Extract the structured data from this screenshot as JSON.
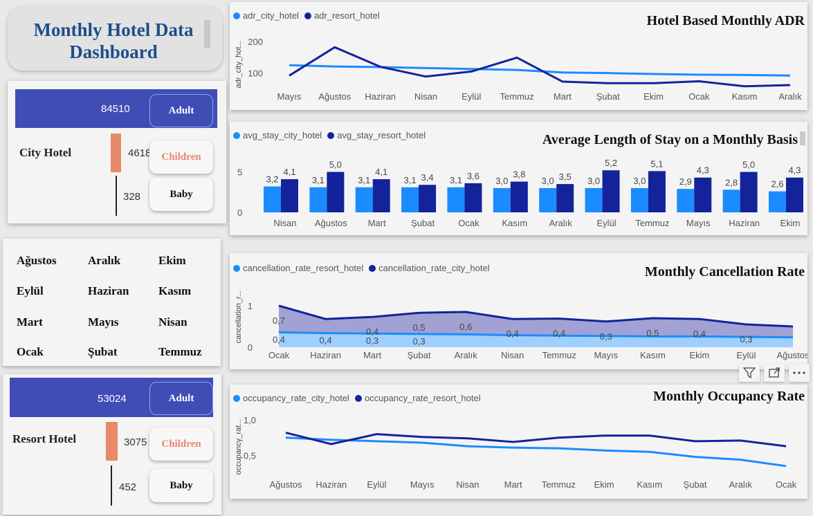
{
  "dashboard": {
    "title_line1": "Monthly Hotel Data",
    "title_line2": "Dashboard"
  },
  "city_guests": {
    "hotel_label": "City Hotel",
    "adult_value": "84510",
    "children_value": "4618",
    "baby_value": "328",
    "adult_label": "Adult",
    "children_label": "Children",
    "baby_label": "Baby"
  },
  "resort_guests": {
    "hotel_label": "Resort Hotel",
    "adult_value": "53024",
    "children_value": "3075",
    "baby_value": "452",
    "adult_label": "Adult",
    "children_label": "Children",
    "baby_label": "Baby"
  },
  "month_slicer": [
    "Ağustos",
    "Aralık",
    "Ekim",
    "Eylül",
    "Haziran",
    "Kasım",
    "Mart",
    "Mayıs",
    "Nisan",
    "Ocak",
    "Şubat",
    "Temmuz"
  ],
  "colors": {
    "city": "#1a8cff",
    "resort": "#14239a",
    "accent": "#3f4db5",
    "orange": "#e8896a"
  },
  "chart_data": [
    {
      "type": "line",
      "title": "Hotel Based Monthly ADR",
      "ylabel": "adr_city_hot...",
      "yticks": [
        "100",
        "200"
      ],
      "ylim": [
        40,
        220
      ],
      "categories": [
        "Mayıs",
        "Ağustos",
        "Haziran",
        "Nisan",
        "Eylül",
        "Temmuz",
        "Mart",
        "Şubat",
        "Ekim",
        "Ocak",
        "Kasım",
        "Aralık"
      ],
      "series": [
        {
          "name": "adr_city_hotel",
          "values": [
            125,
            121,
            119,
            116,
            113,
            110,
            102,
            100,
            97,
            95,
            94,
            92
          ]
        },
        {
          "name": "adr_resort_hotel",
          "values": [
            92,
            182,
            120,
            89,
            105,
            149,
            73,
            68,
            68,
            74,
            58,
            62
          ]
        }
      ]
    },
    {
      "type": "bar",
      "title": "Average Length of Stay on a Monthly Basis",
      "yticks": [
        "0",
        "5"
      ],
      "ylim": [
        0,
        6.5
      ],
      "categories": [
        "Nisan",
        "Ağustos",
        "Mart",
        "Şubat",
        "Ocak",
        "Kasım",
        "Aralık",
        "Eylül",
        "Temmuz",
        "Mayıs",
        "Haziran",
        "Ekim"
      ],
      "series": [
        {
          "name": "avg_stay_city_hotel",
          "values": [
            3.2,
            3.1,
            3.1,
            3.1,
            3.1,
            3.0,
            3.0,
            3.0,
            3.0,
            2.9,
            2.8,
            2.6
          ],
          "labels": [
            "3,2",
            "3,1",
            "3,1",
            "3,1",
            "3,1",
            "3,0",
            "3,0",
            "3,0",
            "3,0",
            "2,9",
            "2,8",
            "2,6"
          ]
        },
        {
          "name": "avg_stay_resort_hotel",
          "values": [
            4.1,
            5.0,
            4.1,
            3.4,
            3.6,
            3.8,
            3.5,
            5.2,
            5.1,
            4.3,
            5.0,
            4.3
          ],
          "labels": [
            "4,1",
            "5,0",
            "4,1",
            "3,4",
            "3,6",
            "3,8",
            "3,5",
            "5,2",
            "5,1",
            "4,3",
            "5,0",
            "4,3"
          ]
        }
      ]
    },
    {
      "type": "area",
      "title": "Monthly Cancellation Rate",
      "ylabel": "cancellation_r...",
      "yticks": [
        "0",
        "1"
      ],
      "ylim": [
        0,
        1.1
      ],
      "categories": [
        "Ocak",
        "Haziran",
        "Mart",
        "Şubat",
        "Aralık",
        "Nisan",
        "Temmuz",
        "Mayıs",
        "Kasım",
        "Ekim",
        "Eylül",
        "Ağustos"
      ],
      "series": [
        {
          "name": "cancellation_rate_resort_hotel",
          "values": [
            0.36,
            0.34,
            0.33,
            0.32,
            0.31,
            0.29,
            0.28,
            0.27,
            0.26,
            0.26,
            0.25,
            0.24
          ],
          "labels": [
            "0,4",
            "0,4",
            "0,3",
            "0,3",
            "",
            "",
            "",
            "",
            "",
            "",
            "",
            ""
          ]
        },
        {
          "name": "cancellation_rate_city_hotel",
          "values": [
            1.0,
            0.68,
            0.73,
            0.83,
            0.85,
            0.68,
            0.69,
            0.62,
            0.7,
            0.68,
            0.55,
            0.5
          ],
          "labels": [
            "0,7",
            "",
            "0,4",
            "0,5",
            "0,6",
            "0,4",
            "0,4",
            "0,3",
            "0,5",
            "0,4",
            "0,3",
            ""
          ]
        }
      ]
    },
    {
      "type": "line",
      "title": "Monthly Occupancy Rate",
      "ylabel": "occupancy_rat...",
      "yticks": [
        "0,5",
        "1,0"
      ],
      "ylim": [
        0.28,
        1.05
      ],
      "categories": [
        "Ağustos",
        "Haziran",
        "Eylül",
        "Mayıs",
        "Nisan",
        "Mart",
        "Temmuz",
        "Ekim",
        "Kasım",
        "Şubat",
        "Aralık",
        "Ocak"
      ],
      "series": [
        {
          "name": "occupancy_rate_city_hotel",
          "values": [
            0.75,
            0.72,
            0.7,
            0.68,
            0.63,
            0.61,
            0.6,
            0.57,
            0.55,
            0.48,
            0.44,
            0.35
          ]
        },
        {
          "name": "occupancy_rate_resort_hotel",
          "values": [
            0.82,
            0.66,
            0.8,
            0.76,
            0.74,
            0.69,
            0.75,
            0.78,
            0.78,
            0.7,
            0.71,
            0.63
          ]
        }
      ]
    }
  ]
}
